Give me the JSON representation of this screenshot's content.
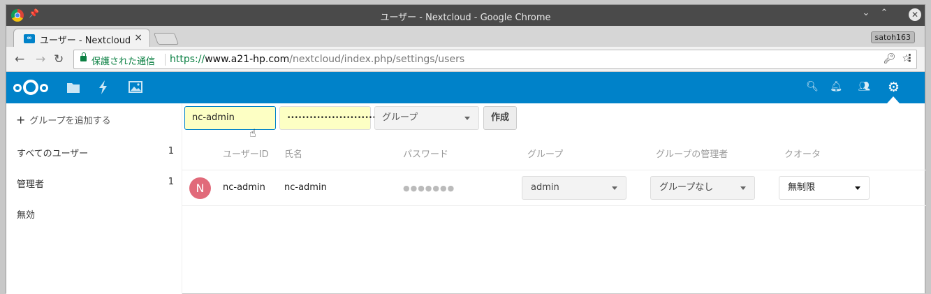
{
  "window": {
    "title": "ユーザー - Nextcloud - Google Chrome"
  },
  "tab": {
    "label": "ユーザー - Nextcloud",
    "close": "×"
  },
  "profile": {
    "name": "satoh163"
  },
  "omnibox": {
    "security_label": "保護された通信",
    "url_scheme": "https://",
    "url_host": "www.a21-hp.com",
    "url_path": "/nextcloud/index.php/settings/users"
  },
  "sidebar": {
    "add_group_label": "グループを追加する",
    "items": [
      {
        "label": "すべてのユーザー",
        "count": "1"
      },
      {
        "label": "管理者",
        "count": "1"
      },
      {
        "label": "無効",
        "count": ""
      }
    ]
  },
  "new_user_form": {
    "username_value": "nc-admin",
    "password_value": "•••••••••••••••••••••••••",
    "group_select": "グループ",
    "create_button": "作成"
  },
  "table": {
    "headers": [
      "ユーザーID",
      "氏名",
      "パスワード",
      "グループ",
      "グループの管理者",
      "クオータ"
    ],
    "rows": [
      {
        "avatar_initial": "N",
        "user_id": "nc-admin",
        "display_name": "nc-admin",
        "password": "●●●●●●●",
        "group": "admin",
        "group_admin": "グループなし",
        "quota": "無制限"
      }
    ]
  },
  "colors": {
    "brand": "#0082c9",
    "avatar": "#e16a7a",
    "input_autofill": "#fdffc4",
    "secure_green": "#0b8043"
  }
}
